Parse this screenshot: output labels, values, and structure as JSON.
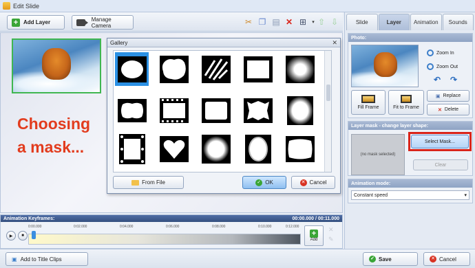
{
  "window": {
    "title": "Edit Slide"
  },
  "toolbar": {
    "add_layer_label": "Add Layer",
    "manage_camera_label": "Manage Camera"
  },
  "stage": {
    "caption_line1": "Choosing",
    "caption_line2": "a mask..."
  },
  "gallery": {
    "title": "Gallery",
    "from_file_label": "From File",
    "ok_label": "OK",
    "cancel_label": "Cancel"
  },
  "keyframes": {
    "title": "Animation Keyframes:",
    "time_display": "00:00.000 / 00:11.000",
    "ruler_ticks": [
      "0:00.000",
      "0:02.000",
      "0:04.000",
      "0:06.000",
      "0:08.000",
      "0:10.000",
      "0:12.000"
    ],
    "add_label": "Add"
  },
  "bottom": {
    "add_to_title_clips_label": "Add to Title Clips",
    "save_label": "Save",
    "cancel_label": "Cancel"
  },
  "panel": {
    "tabs": [
      "Slide",
      "Layer",
      "Animation",
      "Sounds"
    ],
    "active_tab": "Layer",
    "photo": {
      "heading": "Photo:",
      "zoom_in_label": "Zoom In",
      "zoom_out_label": "Zoom Out",
      "fill_frame_label": "Fill Frame",
      "fit_to_frame_label": "Fit to Frame",
      "replace_label": "Replace",
      "delete_label": "Delete"
    },
    "layer_mask": {
      "heading": "Layer mask - change layer shape:",
      "no_mask_text": "(no mask selected)",
      "select_mask_label": "Select Mask...",
      "clear_label": "Clear"
    },
    "animation_mode": {
      "heading": "Animation mode:",
      "value": "Constant speed"
    }
  },
  "colors": {
    "accent_red": "#e23c1e",
    "selection_blue": "#2b90e4",
    "highlight_red": "#d9241a"
  }
}
